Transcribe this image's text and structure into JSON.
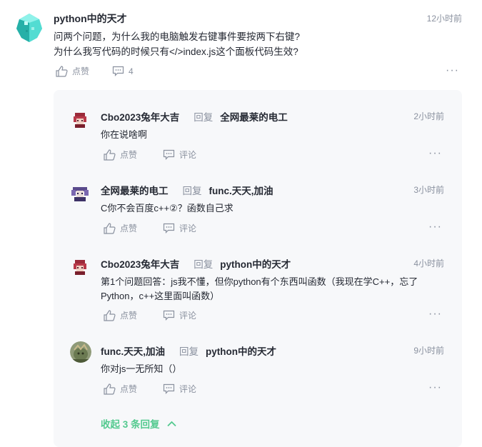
{
  "main": {
    "author": "python中的天才",
    "time": "12小时前",
    "text_line1": "问两个问题，为什么我的电脑触发右键事件要按两下右键?",
    "text_line2": "为什么我写代码的时候只有</>index.js这个面板代码生效?",
    "like_label": "点赞",
    "comment_count": "4",
    "more": "···"
  },
  "replies": [
    {
      "author": "Cbo2023兔年大吉",
      "reply_word": "回复",
      "target": "全网最莱的电工",
      "time": "2小时前",
      "text": "你在说啥啊",
      "like_label": "点赞",
      "comment_label": "评论",
      "more": "···"
    },
    {
      "author": "全网最莱的电工",
      "reply_word": "回复",
      "target": "func.天天,加油",
      "time": "3小时前",
      "text": "C你不会百度c++②？函数自己求",
      "like_label": "点赞",
      "comment_label": "评论",
      "more": "···"
    },
    {
      "author": "Cbo2023兔年大吉",
      "reply_word": "回复",
      "target": "python中的天才",
      "time": "4小时前",
      "text_line1": "第1个问题回答：js我不懂，但你python有个东西叫函数（我现在学C++，忘了",
      "text_line2": "Python，c++这里面叫函数）",
      "like_label": "点赞",
      "comment_label": "评论",
      "more": "···"
    },
    {
      "author": "func.天天,加油",
      "reply_word": "回复",
      "target": "python中的天才",
      "time": "9小时前",
      "text": "你对js一无所知（）",
      "like_label": "点赞",
      "comment_label": "评论",
      "more": "···"
    }
  ],
  "collapse_label": "收起 3 条回复",
  "colors": {
    "accent": "#52c98e",
    "muted": "#8a919f",
    "text": "#252933",
    "reply_bg": "#f7f8fa"
  }
}
